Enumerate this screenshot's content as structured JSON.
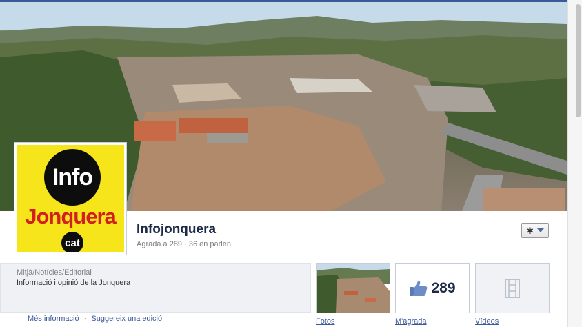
{
  "page": {
    "name": "Infojonquera",
    "stats": "Agrada a 289 · 36 en parlen"
  },
  "logo": {
    "top_text": "Info",
    "middle_text": "Jonquera",
    "bottom_text": "cat"
  },
  "about": {
    "category": "Mitjà/Notícies/Editorial",
    "description": "Informació i opinió de la Jonquera"
  },
  "links": {
    "more_info": "Més informació",
    "separator": "·",
    "suggest_edit": "Suggereix una edició"
  },
  "apps": {
    "photos_label": "Fotos",
    "likes_label": "M'agrada",
    "likes_count": "289",
    "videos_label": "Vídeos"
  },
  "icons": {
    "gear": "gear-icon",
    "caret": "chevron-down-icon",
    "thumb": "thumbs-up-icon",
    "film": "film-icon"
  },
  "colors": {
    "brand": "#3b5998",
    "logo_yellow": "#f7e51c",
    "logo_red": "#d31f1f"
  }
}
